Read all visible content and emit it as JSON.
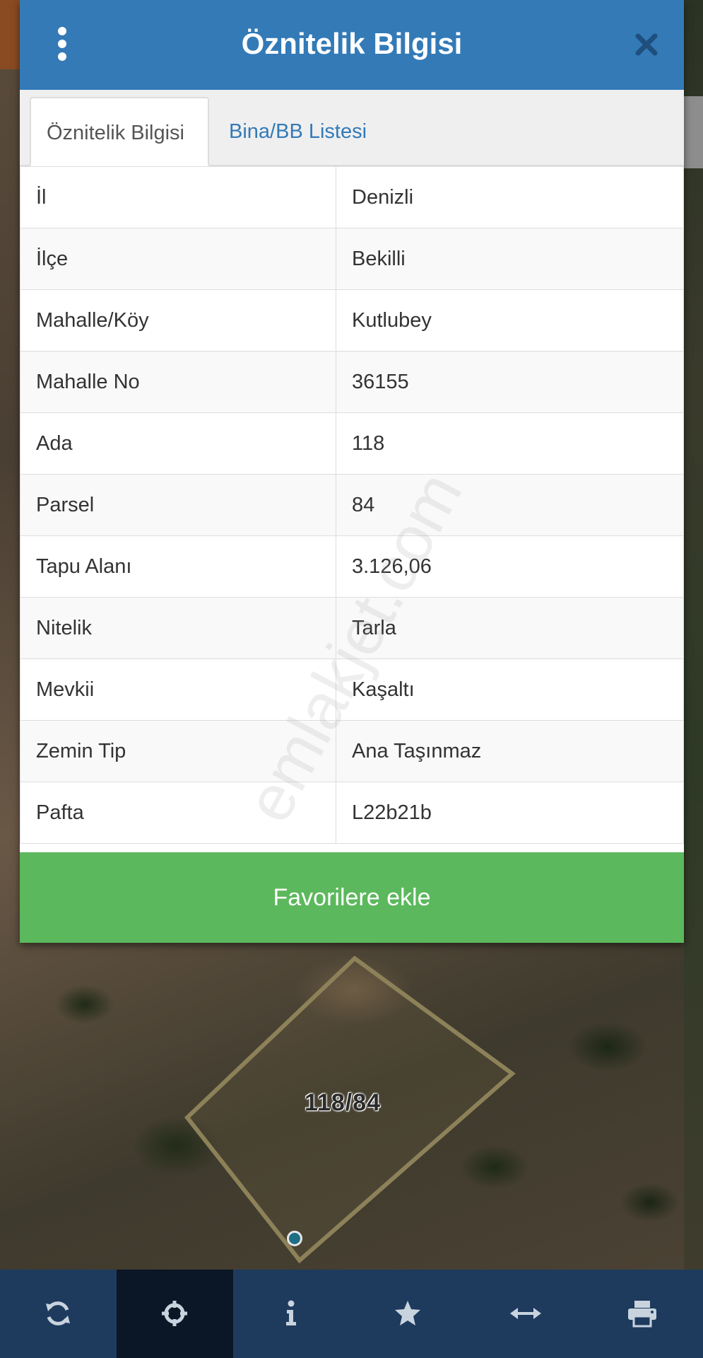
{
  "dialog": {
    "title": "Öznitelik Bilgisi",
    "tabs": [
      {
        "label": "Öznitelik Bilgisi",
        "active": true
      },
      {
        "label": "Bina/BB Listesi",
        "active": false
      }
    ],
    "rows": [
      {
        "key": "İl",
        "value": "Denizli"
      },
      {
        "key": "İlçe",
        "value": "Bekilli"
      },
      {
        "key": "Mahalle/Köy",
        "value": "Kutlubey"
      },
      {
        "key": "Mahalle No",
        "value": "36155"
      },
      {
        "key": "Ada",
        "value": "118"
      },
      {
        "key": "Parsel",
        "value": "84"
      },
      {
        "key": "Tapu Alanı",
        "value": "3.126,06"
      },
      {
        "key": "Nitelik",
        "value": "Tarla"
      },
      {
        "key": "Mevkii",
        "value": "Kaşaltı"
      },
      {
        "key": "Zemin Tip",
        "value": "Ana Taşınmaz"
      },
      {
        "key": "Pafta",
        "value": "L22b21b"
      }
    ],
    "favorite_button": "Favorilere ekle"
  },
  "watermark": "emlakjet.com",
  "map": {
    "parcel_label": "118/84"
  },
  "toolbar": {
    "items": [
      {
        "icon": "refresh-icon",
        "active": false
      },
      {
        "icon": "crosshair-icon",
        "active": true
      },
      {
        "icon": "info-icon",
        "active": false
      },
      {
        "icon": "star-icon",
        "active": false
      },
      {
        "icon": "measure-arrows-icon",
        "active": false
      },
      {
        "icon": "print-icon",
        "active": false
      }
    ]
  },
  "colors": {
    "header": "#337ab7",
    "favorite_button": "#5cb85c",
    "toolbar": "#1e3b5e",
    "toolbar_active": "#0b1626",
    "parcel_outline": "#8c8158"
  }
}
